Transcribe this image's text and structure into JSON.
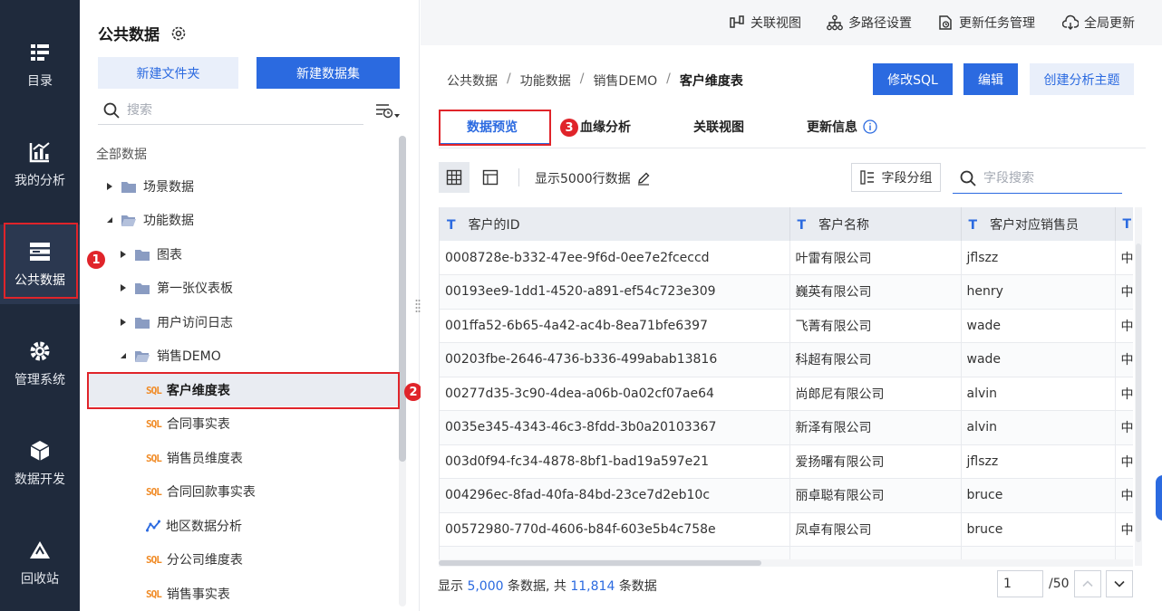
{
  "nav": {
    "items": [
      {
        "label": "目录",
        "icon": "catalog-icon"
      },
      {
        "label": "我的分析",
        "icon": "chart-icon"
      },
      {
        "label": "公共数据",
        "icon": "database-icon",
        "active": true
      },
      {
        "label": "管理系统",
        "icon": "gear-icon"
      },
      {
        "label": "数据开发",
        "icon": "cube-icon"
      },
      {
        "label": "回收站",
        "icon": "recycle-icon"
      }
    ]
  },
  "tree": {
    "title": "公共数据",
    "new_folder": "新建文件夹",
    "new_dataset": "新建数据集",
    "search_placeholder": "搜索",
    "all_data": "全部数据",
    "items": [
      {
        "label": "场景数据",
        "type": "folder",
        "expanded": false
      },
      {
        "label": "功能数据",
        "type": "folder",
        "expanded": true
      },
      {
        "label": "图表",
        "type": "folder",
        "expanded": false
      },
      {
        "label": "第一张仪表板",
        "type": "folder",
        "expanded": false
      },
      {
        "label": "用户访问日志",
        "type": "folder",
        "expanded": false
      },
      {
        "label": "销售DEMO",
        "type": "folder",
        "expanded": true
      },
      {
        "label": "客户维度表",
        "type": "sql",
        "selected": true
      },
      {
        "label": "合同事实表",
        "type": "sql"
      },
      {
        "label": "销售员维度表",
        "type": "sql"
      },
      {
        "label": "合同回款事实表",
        "type": "sql"
      },
      {
        "label": "地区数据分析",
        "type": "analysis"
      },
      {
        "label": "分公司维度表",
        "type": "sql"
      },
      {
        "label": "销售事实表",
        "type": "sql"
      }
    ],
    "sql_tag": "SQL"
  },
  "badges": {
    "one": "1",
    "two": "2",
    "three": "3"
  },
  "toolbar": {
    "relation_view": "关联视图",
    "multipath": "多路径设置",
    "update_tasks": "更新任务管理",
    "global_update": "全局更新"
  },
  "breadcrumb": {
    "items": [
      "公共数据",
      "功能数据",
      "销售DEMO"
    ],
    "current": "客户维度表",
    "separator": "/"
  },
  "actions": {
    "modify_sql": "修改SQL",
    "edit": "编辑",
    "create_theme": "创建分析主题"
  },
  "tabs": {
    "preview": "数据预览",
    "lineage": "血缘分析",
    "relation": "关联视图",
    "update_info": "更新信息"
  },
  "viewbar": {
    "rows_label": "显示5000行数据",
    "group_label": "字段分组",
    "search_placeholder": "字段搜索"
  },
  "table": {
    "columns": [
      "客户的ID",
      "客户名称",
      "客户对应销售员",
      ""
    ],
    "rows": [
      [
        "0008728e-b332-47ee-9f6d-0ee7e2fceccd",
        "叶雷有限公司",
        "jflszz",
        "中"
      ],
      [
        "00193ee9-1dd1-4520-a891-ef54c723e309",
        "巍英有限公司",
        "henry",
        "中"
      ],
      [
        "001ffa52-6b65-4a42-ac4b-8ea71bfe6397",
        "飞菁有限公司",
        "wade",
        "中"
      ],
      [
        "00203fbe-2646-4736-b336-499abab13816",
        "科超有限公司",
        "wade",
        "中"
      ],
      [
        "00277d35-3c90-4dea-a06b-0a02cf07ae64",
        "尚郎尼有限公司",
        "alvin",
        "中"
      ],
      [
        "0035e345-4343-46c3-8fdd-3b0a20103367",
        "新泽有限公司",
        "alvin",
        "中"
      ],
      [
        "003d0f94-fc34-4878-8bf1-bad19a597e21",
        "爱扬曙有限公司",
        "jflszz",
        "中"
      ],
      [
        "004296ec-8fad-40fa-84bd-23ce7d2eb10c",
        "丽卓聪有限公司",
        "bruce",
        "中"
      ],
      [
        "00572980-770d-4606-b84f-603e5b4c758e",
        "凤卓有限公司",
        "bruce",
        "中"
      ],
      [
        "",
        "",
        "",
        ""
      ]
    ]
  },
  "footer": {
    "prefix": "显示",
    "shown": "5,000",
    "mid": "条数据, 共",
    "total": "11,814",
    "suffix": "条数据",
    "page_value": "1",
    "page_total": "/50"
  },
  "colors": {
    "accent": "#2b6ae0",
    "nav_bg": "#1f2a3c",
    "highlight": "#e0242a",
    "sql_orange": "#f08a24"
  }
}
